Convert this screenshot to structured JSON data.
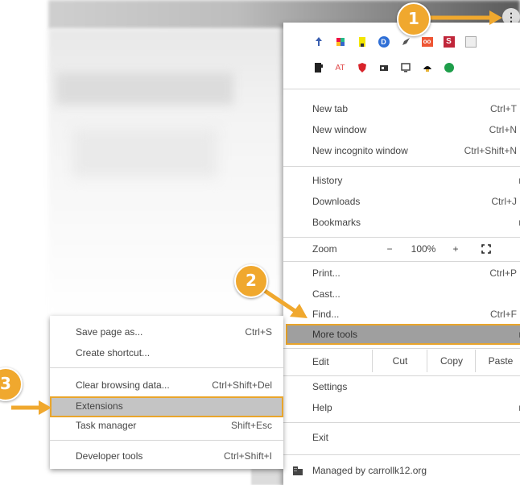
{
  "callouts": {
    "step1": "1",
    "step2": "2",
    "step3": "3"
  },
  "menu": {
    "extensions_row1": [
      "ext-pin",
      "ext-cube",
      "ext-highlighter",
      "ext-d",
      "ext-rocket",
      "ext-oo",
      "ext-s",
      "ext-box"
    ],
    "extensions_row2": [
      "ext-bookmark",
      "ext-at",
      "ext-shield",
      "ext-id",
      "ext-monitor",
      "ext-helmet",
      "ext-dot"
    ],
    "ext_text": {
      "at": "AT",
      "d": "D",
      "oo": "oo",
      "s": "S"
    },
    "new_tab": "New tab",
    "new_tab_sc": "Ctrl+T",
    "new_window": "New window",
    "new_window_sc": "Ctrl+N",
    "new_incognito": "New incognito window",
    "new_incognito_sc": "Ctrl+Shift+N",
    "history": "History",
    "downloads": "Downloads",
    "downloads_sc": "Ctrl+J",
    "bookmarks": "Bookmarks",
    "zoom": "Zoom",
    "zoom_minus": "−",
    "zoom_value": "100%",
    "zoom_plus": "+",
    "print": "Print...",
    "print_sc": "Ctrl+P",
    "cast": "Cast...",
    "find": "Find...",
    "find_sc": "Ctrl+F",
    "more_tools": "More tools",
    "edit": "Edit",
    "cut": "Cut",
    "copy": "Copy",
    "paste": "Paste",
    "settings": "Settings",
    "help": "Help",
    "exit": "Exit",
    "managed": "Managed by carrollk12.org"
  },
  "submenu": {
    "save_page": "Save page as...",
    "save_page_sc": "Ctrl+S",
    "create_shortcut": "Create shortcut...",
    "clear_data": "Clear browsing data...",
    "clear_data_sc": "Ctrl+Shift+Del",
    "extensions": "Extensions",
    "task_manager": "Task manager",
    "task_manager_sc": "Shift+Esc",
    "dev_tools": "Developer tools",
    "dev_tools_sc": "Ctrl+Shift+I"
  },
  "colors": {
    "accent": "#f0a82e",
    "highlight": "#9f9f9f"
  }
}
